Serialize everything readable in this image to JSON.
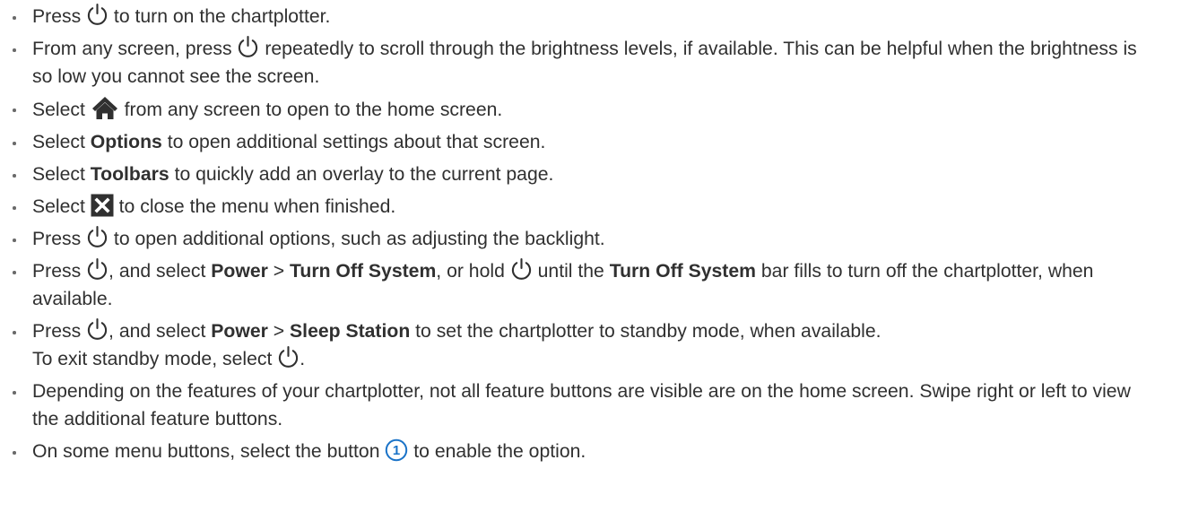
{
  "items": [
    {
      "p1": "Press ",
      "p2": " to turn on the chartplotter."
    },
    {
      "p1": "From any screen, press ",
      "p2": " repeatedly to scroll through the brightness levels, if available. This can be helpful when the brightness is so low you cannot see the screen."
    },
    {
      "p1": "Select ",
      "p2": " from any screen to open to the home screen."
    },
    {
      "p1": "Select ",
      "b1": "Options",
      "p2": " to open additional settings about that screen."
    },
    {
      "p1": "Select ",
      "b1": "Toolbars",
      "p2": " to quickly add an overlay to the current page."
    },
    {
      "p1": "Select ",
      "p2": " to close the menu when finished."
    },
    {
      "p1": "Press ",
      "p2": " to open additional options, such as adjusting the backlight."
    },
    {
      "p1": "Press ",
      "p2": ", and select ",
      "b1": "Power",
      "p3": " > ",
      "b2": "Turn Off System",
      "p4": ", or hold ",
      "p5": " until the ",
      "b3": "Turn Off System",
      "p6": " bar fills to turn off the chartplotter, when available."
    },
    {
      "p1": "Press ",
      "p2": ", and select ",
      "b1": "Power",
      "p3": " > ",
      "b2": "Sleep Station",
      "p4": " to set the chartplotter to standby mode, when available.",
      "sub1": "To exit standby mode, select ",
      "sub2": "."
    },
    {
      "p1": "Depending on the features of your chartplotter, not all feature buttons are visible are on the home screen. Swipe right or left to view the additional feature buttons."
    },
    {
      "p1": "On some menu buttons, select the button ",
      "p2": " to enable the option."
    }
  ],
  "callout_number": "1",
  "colors": {
    "text": "#303030",
    "icon": "#303030",
    "callout": "#1a73c8"
  }
}
